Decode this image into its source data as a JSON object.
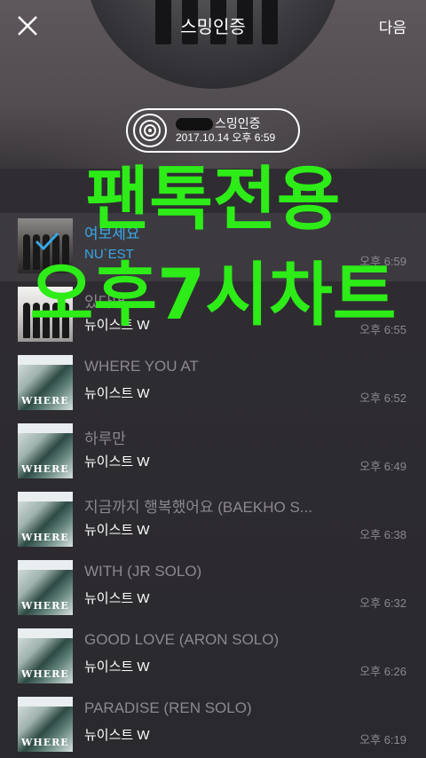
{
  "header": {
    "hero_title": "스밍인증",
    "next_label": "다음"
  },
  "badge": {
    "name": "스밍인증",
    "date": "2017.10.14 오후 6:59"
  },
  "overlay": {
    "line1": "팬톡전용",
    "line2": "오후7시차트"
  },
  "songs": [
    {
      "title": "여보세요",
      "artist": "NU`EST",
      "time": "오후 6:59",
      "active": true,
      "thumb": "photo"
    },
    {
      "title": "있다면",
      "artist": "뉴이스트 W",
      "time": "오후 6:55",
      "active": false,
      "thumb": "photo2"
    },
    {
      "title": "WHERE YOU AT",
      "artist": "뉴이스트 W",
      "time": "오후 6:52",
      "active": false,
      "thumb": "album"
    },
    {
      "title": "하루만",
      "artist": "뉴이스트 W",
      "time": "오후 6:49",
      "active": false,
      "thumb": "album"
    },
    {
      "title": "지금까지 행복했어요 (BAEKHO S...",
      "artist": "뉴이스트 W",
      "time": "오후 6:38",
      "active": false,
      "thumb": "album"
    },
    {
      "title": "WITH (JR SOLO)",
      "artist": "뉴이스트 W",
      "time": "오후 6:32",
      "active": false,
      "thumb": "album"
    },
    {
      "title": "GOOD LOVE (ARON SOLO)",
      "artist": "뉴이스트 W",
      "time": "오후 6:26",
      "active": false,
      "thumb": "album"
    },
    {
      "title": "PARADISE (REN SOLO)",
      "artist": "뉴이스트 W",
      "time": "오후 6:19",
      "active": false,
      "thumb": "album"
    }
  ],
  "album_art_text": "WHERE",
  "colors": {
    "overlay_green": "#2dec18",
    "active_blue": "#38a7e8"
  }
}
